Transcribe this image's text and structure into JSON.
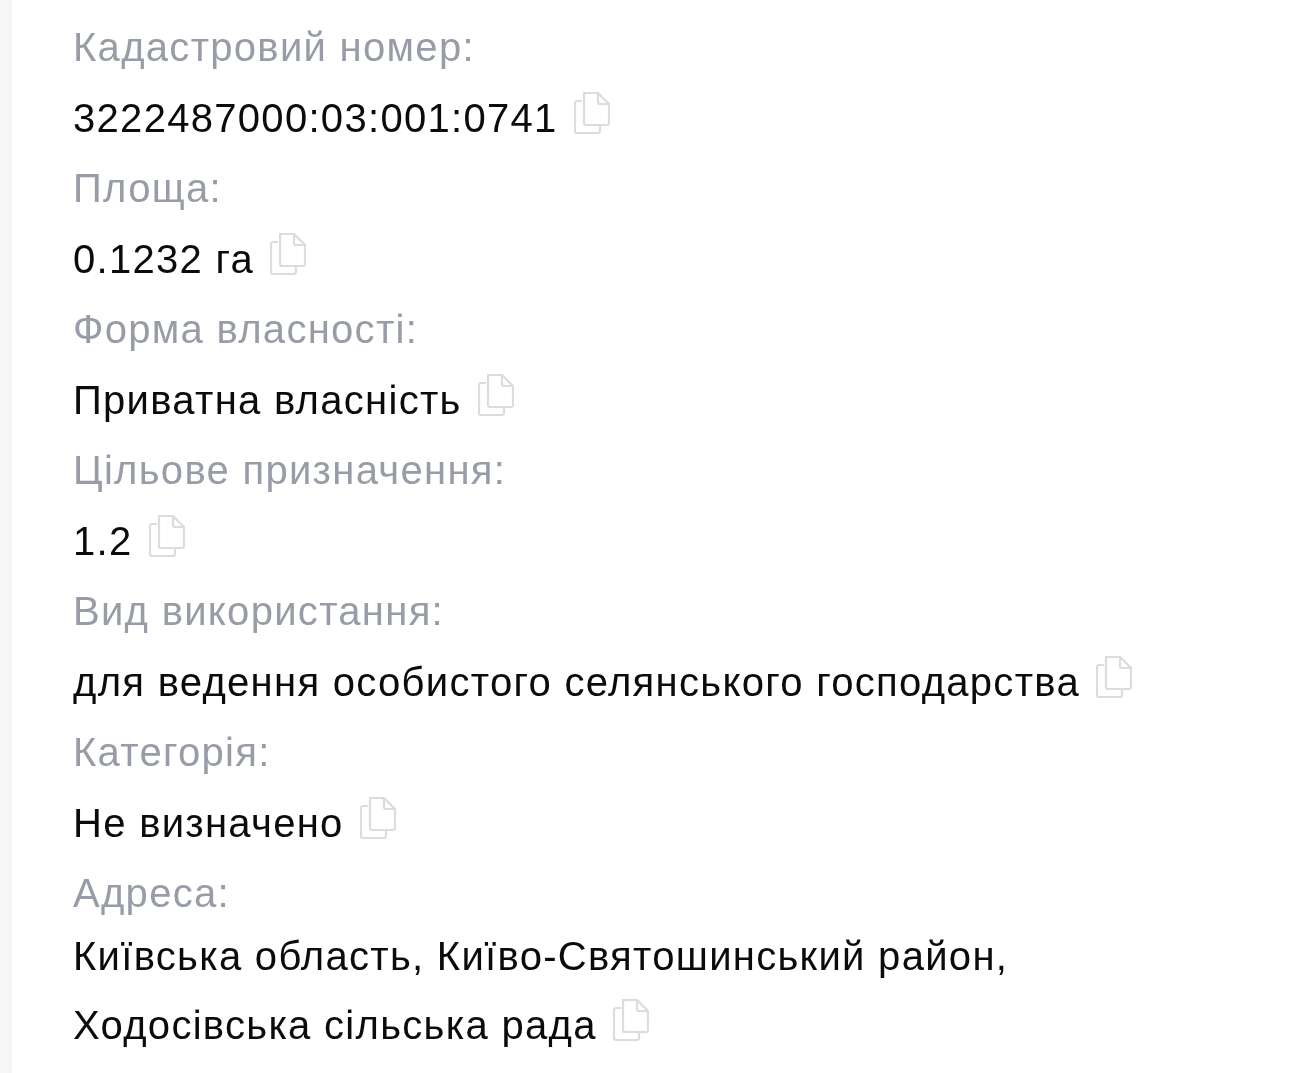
{
  "fields": [
    {
      "label": "Кадастровий номер:",
      "lines": [
        "3222487000:03:001:0741"
      ]
    },
    {
      "label": "Площа:",
      "lines": [
        "0.1232 га"
      ]
    },
    {
      "label": "Форма власності:",
      "lines": [
        "Приватна власність"
      ]
    },
    {
      "label": "Цільове призначення:",
      "lines": [
        "1.2"
      ]
    },
    {
      "label": "Вид використання:",
      "lines": [
        "для ведення особистого селянського господарства"
      ]
    },
    {
      "label": "Категорія:",
      "lines": [
        "Не визначено"
      ]
    },
    {
      "label": "Адреса:",
      "lines": [
        "Київська область, Київо-Святошинський район,",
        "Ходосівська сільська рада"
      ]
    }
  ]
}
